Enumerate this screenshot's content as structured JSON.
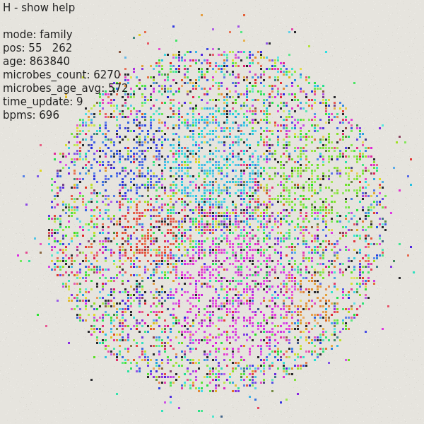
{
  "hud": {
    "help_hint": "H - show help",
    "lines": [
      "mode: family",
      "pos: 55   262",
      "age: 863840",
      "microbes_count: 6270",
      "microbes_age_avg: 572",
      "time_update: 9",
      "bpms: 696"
    ]
  }
}
